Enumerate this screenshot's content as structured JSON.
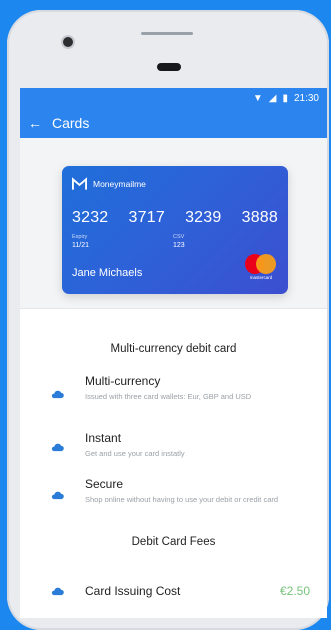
{
  "statusBar": {
    "time": "21:30"
  },
  "appBar": {
    "title": "Cards"
  },
  "card": {
    "brand": "Moneymailme",
    "numberGroups": [
      "3232",
      "3717",
      "3239",
      "3888"
    ],
    "expiryLabel": "Expiry",
    "expiry": "11/21",
    "cvvLabel": "CSV",
    "cvv": "123",
    "holder": "Jane Michaels",
    "network": "mastercard"
  },
  "sections": {
    "features_title": "Multi-currency debit card",
    "fees_title": "Debit Card Fees"
  },
  "features": [
    {
      "title": "Multi-currency",
      "description": "Issued with three card wallets: Eur, GBP and USD"
    },
    {
      "title": "Instant",
      "description": "Get and use your card instatly"
    },
    {
      "title": "Secure",
      "description": "Shop online without having to use your debit or credit card"
    }
  ],
  "fees": [
    {
      "label": "Card Issuing Cost",
      "amount": "€2.50"
    }
  ],
  "colors": {
    "background": "#1c87ee",
    "appBar": "#2c85ee",
    "feeAmount": "#76c37a"
  }
}
